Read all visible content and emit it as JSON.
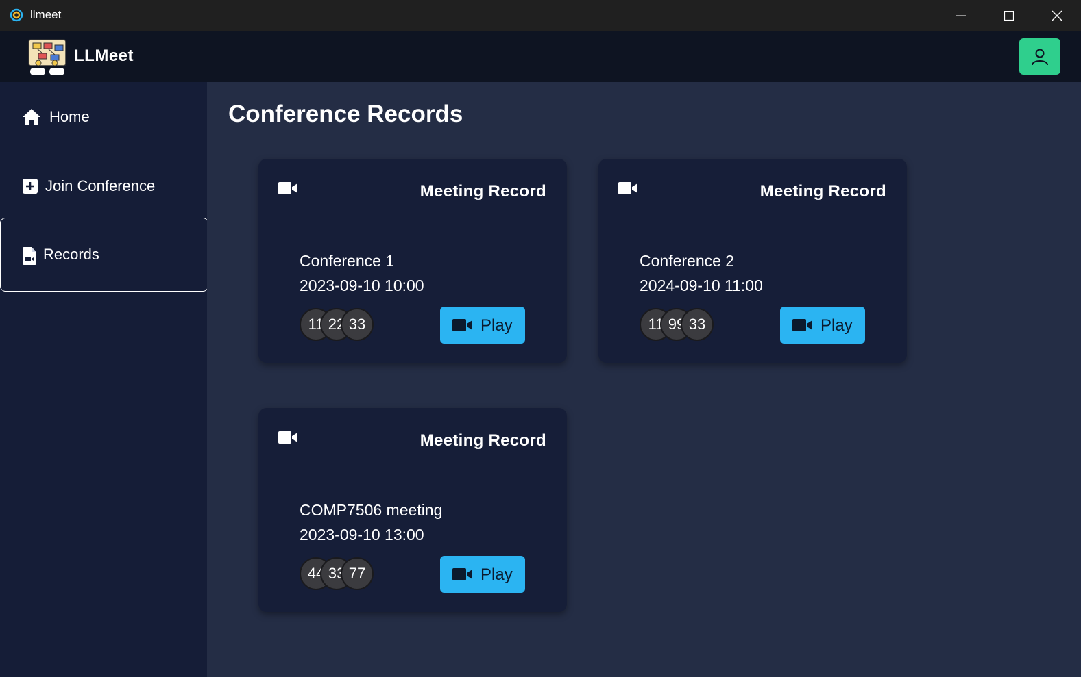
{
  "window": {
    "title": "llmeet"
  },
  "header": {
    "brand": "LLMeet"
  },
  "sidebar": {
    "items": [
      {
        "label": "Home",
        "icon": "home-icon"
      },
      {
        "label": "Join Conference",
        "icon": "plus-square-icon"
      },
      {
        "label": "Records",
        "icon": "file-video-icon",
        "active": true
      }
    ]
  },
  "main": {
    "title": "Conference Records",
    "cards": [
      {
        "heading": "Meeting Record",
        "name": "Conference 1",
        "time": "2023-09-10 10:00",
        "participants": [
          "11",
          "22",
          "33"
        ],
        "play_label": "Play"
      },
      {
        "heading": "Meeting Record",
        "name": "Conference 2",
        "time": "2024-09-10 11:00",
        "participants": [
          "11",
          "99",
          "33"
        ],
        "play_label": "Play"
      },
      {
        "heading": "Meeting Record",
        "name": "COMP7506 meeting",
        "time": "2023-09-10 13:00",
        "participants": [
          "44",
          "33",
          "77"
        ],
        "play_label": "Play"
      }
    ]
  },
  "colors": {
    "accent_green": "#2fcf8d",
    "play_blue": "#2bb4f2",
    "sidebar_bg": "#151d37",
    "main_bg": "#242d45",
    "card_bg": "#161e38"
  }
}
